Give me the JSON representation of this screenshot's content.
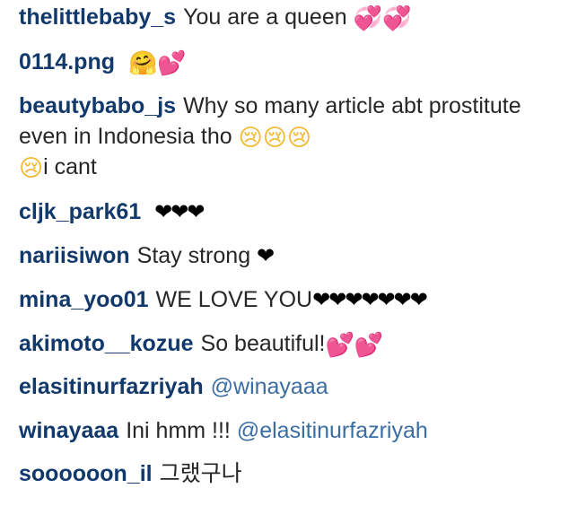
{
  "colors": {
    "username": "#12396b",
    "mention": "#3b6da3",
    "text": "#262626",
    "heart_pink": "#e4499b",
    "emoji_yellow": "#f2b72b"
  },
  "comments": [
    {
      "username": "thelittlebaby_s",
      "text": "You are a queen",
      "emoji": "💞💞"
    },
    {
      "username": "0114.png",
      "text": "",
      "emoji": "🤗💕"
    },
    {
      "username": "beautybabo_js",
      "text_1": "Why so many article abt prostitute even in Indonesia tho",
      "emoji_1": "😢😢😢",
      "emoji_2": "😢",
      "text_2": "i cant"
    },
    {
      "username": "cljk_park61",
      "text": "",
      "emoji": "❤❤❤"
    },
    {
      "username": "nariisiwon",
      "text": "Stay strong",
      "emoji": "❤"
    },
    {
      "username": "mina_yoo01",
      "text": "WE LOVE YOU",
      "emoji": "❤❤❤❤❤❤❤"
    },
    {
      "username": "akimoto__kozue",
      "text": "So beautiful!",
      "emoji": "💕💕"
    },
    {
      "username": "elasitinurfazriyah",
      "mention": "@winayaaa"
    },
    {
      "username": "winayaaa",
      "text": "Ini hmm !!!",
      "mention": "@elasitinurfazriyah"
    },
    {
      "username": "soooooon_il",
      "text": "그랬구나"
    }
  ]
}
